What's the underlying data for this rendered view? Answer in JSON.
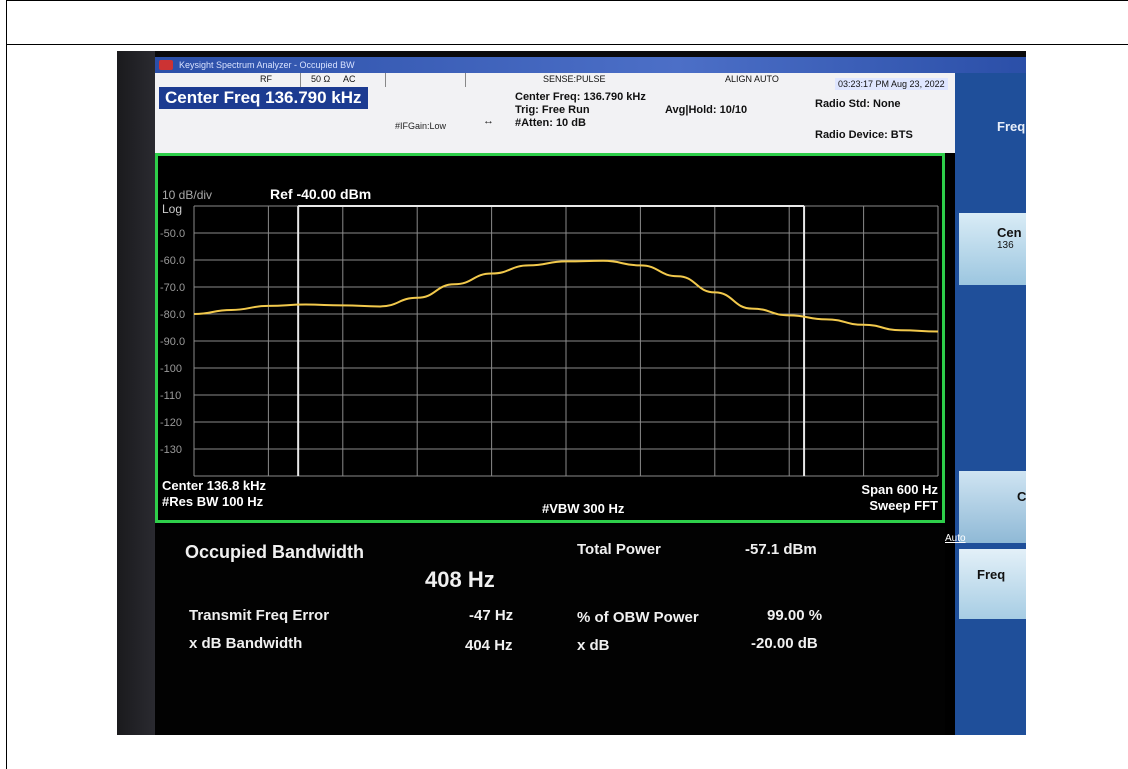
{
  "window": {
    "title": "Keysight Spectrum Analyzer - Occupied BW"
  },
  "header": {
    "rf": "RF",
    "impedance": "50 Ω",
    "coupling": "AC",
    "sense": "SENSE:PULSE",
    "align": "ALIGN AUTO",
    "timestamp": "03:23:17 PM Aug 23, 2022",
    "center_freq_title": "Center Freq 136.790 kHz",
    "center_freq_line": "Center Freq: 136.790 kHz",
    "trig": "Trig: Free Run",
    "avg_hold": "Avg|Hold: 10/10",
    "atten": "#Atten: 10 dB",
    "ifgain": "#IFGain:Low",
    "radio_std": "Radio Std: None",
    "radio_device": "Radio Device: BTS"
  },
  "softkeys": {
    "freq": "Freq",
    "center": "Cen",
    "center_value": "136",
    "c": "C",
    "auto": "Auto",
    "freq_offset": "Freq"
  },
  "graph": {
    "scale": "10 dB/div",
    "log": "Log",
    "ref": "Ref -40.00 dBm",
    "center": "Center  136.8 kHz",
    "res_bw": "#Res BW  100 Hz",
    "vbw": "#VBW  300 Hz",
    "span": "Span 600 Hz",
    "sweep": "Sweep FFT",
    "trace_color": "#f2c94c",
    "grid_color": "#8a8a8a",
    "border_color": "#2ecf4a"
  },
  "chart_data": {
    "type": "line",
    "title": "",
    "xlabel": "",
    "ylabel": "",
    "x": [
      136.5,
      136.53,
      136.56,
      136.59,
      136.62,
      136.65,
      136.68,
      136.71,
      136.74,
      136.77,
      136.8,
      136.83,
      136.86,
      136.89,
      136.92,
      136.95,
      136.98,
      137.01,
      137.04,
      137.07,
      137.1
    ],
    "series": [
      {
        "values": [
          -80,
          -78.5,
          -77,
          -76.5,
          -76.8,
          -77.2,
          -74,
          -69,
          -65,
          -62,
          -60.5,
          -60.3,
          -62,
          -66,
          -72,
          -78,
          -80.5,
          -82,
          -84,
          -86,
          -86.5
        ]
      }
    ],
    "xlim": [
      136.5,
      137.1
    ],
    "ylim": [
      -140,
      -40
    ],
    "yticks": [
      "-50.0",
      "-60.0",
      "-70.0",
      "-80.0",
      "-90.0",
      "-100",
      "-110",
      "-120",
      "-130"
    ],
    "grid": true,
    "obw_markers": [
      136.584,
      136.992
    ]
  },
  "results": {
    "title": "Occupied Bandwidth",
    "obw_value": "408 Hz",
    "total_power_label": "Total Power",
    "total_power_value": "-57.1 dBm",
    "tx_freq_error_label": "Transmit Freq Error",
    "tx_freq_error_value": "-47 Hz",
    "obw_power_label": "% of OBW Power",
    "obw_power_value": "99.00 %",
    "xdb_bw_label": "x dB Bandwidth",
    "xdb_bw_value": "404 Hz",
    "xdb_label": "x dB",
    "xdb_value": "-20.00 dB"
  }
}
